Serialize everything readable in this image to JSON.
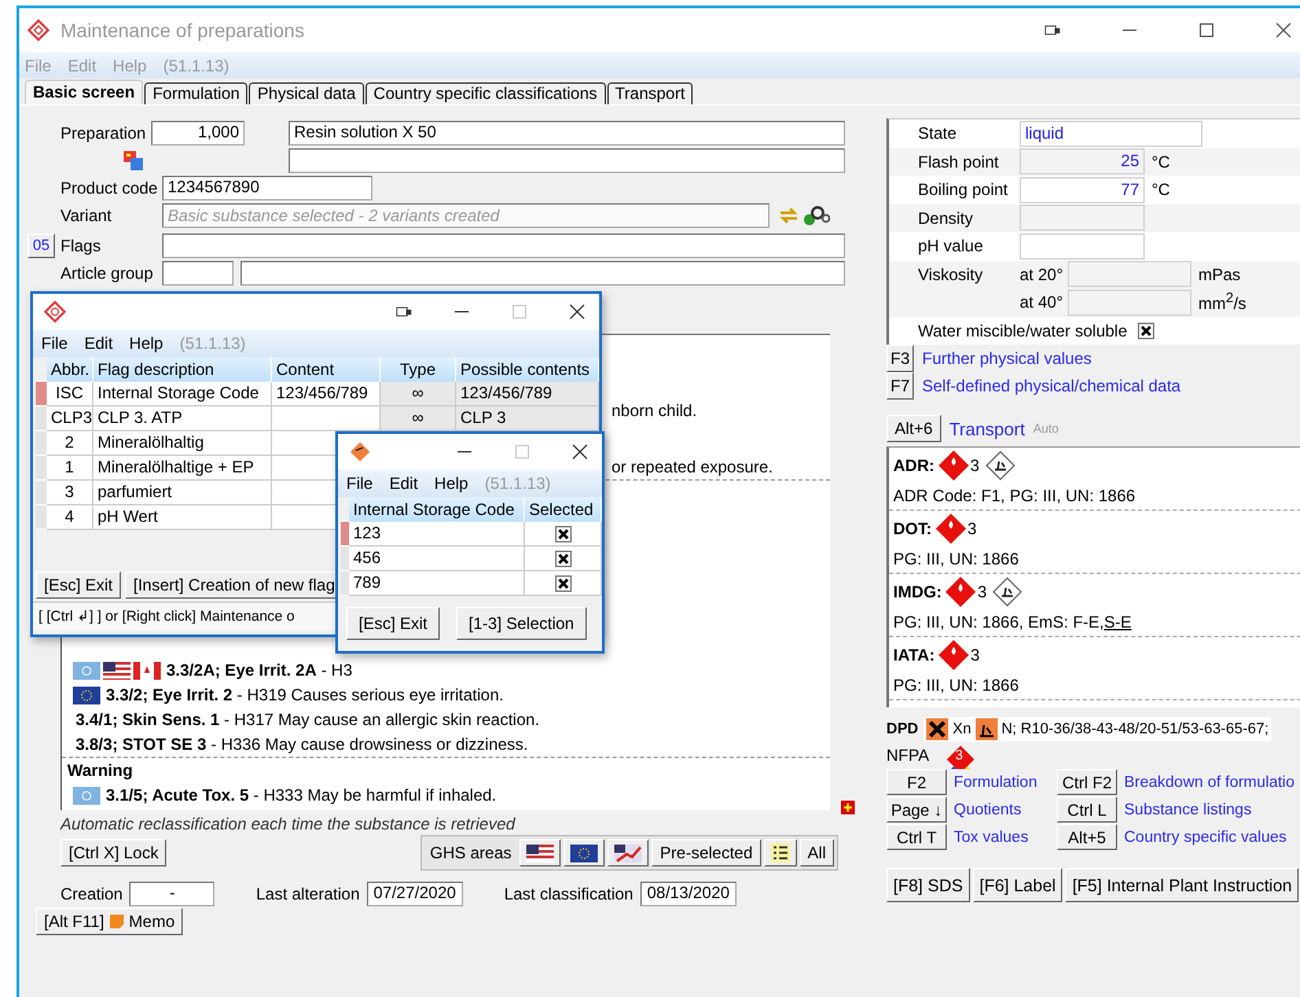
{
  "main_window": {
    "title": "Maintenance of preparations",
    "menu": [
      "File",
      "Edit",
      "Help"
    ],
    "version": "(51.1.13)"
  },
  "tabs": [
    {
      "label": "Basic screen",
      "selected": true
    },
    {
      "label": "Formulation",
      "selected": false
    },
    {
      "label": "Physical data",
      "selected": false
    },
    {
      "label": "Country specific classifications",
      "selected": false
    },
    {
      "label": "Transport",
      "selected": false
    }
  ],
  "form": {
    "preparation_label": "Preparation",
    "preparation_number": "1,000",
    "preparation_name": "Resin solution X 50",
    "product_code_label": "Product code",
    "product_code": "1234567890",
    "variant_label": "Variant",
    "variant_placeholder": "Basic substance selected - 2 variants created",
    "flags_button": "05",
    "flags_label": "Flags",
    "article_group_label": "Article group"
  },
  "hazards": [
    {
      "kind": "fragment",
      "text": "nborn child."
    },
    {
      "kind": "fragment",
      "text": "or repeated exposure."
    },
    {
      "kind": "item",
      "flags": [
        {
          "kind": "un"
        },
        {
          "kind": "us"
        },
        {
          "kind": "ca"
        }
      ],
      "text": "**3.3/2A; Eye Irrit. 2A** - H3"
    },
    {
      "kind": "item",
      "flags": [
        {
          "kind": "eu"
        }
      ],
      "text": "**3.3/2; Eye Irrit. 2** - H319 Causes serious eye irritation."
    },
    {
      "kind": "item",
      "text": "**3.4/1; Skin Sens. 1** - H317 May cause an allergic skin reaction."
    },
    {
      "kind": "item",
      "text": "**3.8/3; STOT SE 3** - H336 May cause drowsiness or dizziness."
    },
    {
      "kind": "heading",
      "text": "Warning"
    },
    {
      "kind": "item",
      "flags": [
        {
          "kind": "un"
        }
      ],
      "text": "**3.1/5; Acute Tox. 5** - H333 May be harmful if inhaled."
    }
  ],
  "reclassification_note": "Automatic reclassification each time the substance is retrieved",
  "lock_button": "[Ctrl X] Lock",
  "ghs_toolbar": {
    "label": "GHS areas",
    "buttons": [
      {
        "kind": "us"
      },
      {
        "kind": "eu"
      },
      {
        "kind": "chart"
      },
      {
        "kind": "text",
        "label": "Pre-selected"
      },
      {
        "kind": "list"
      },
      {
        "kind": "text",
        "label": "All"
      }
    ]
  },
  "dates": [
    {
      "label": "Creation",
      "value": "-"
    },
    {
      "label": "Last alteration",
      "value": "07/27/2020"
    },
    {
      "label": "Last classification",
      "value": "08/13/2020"
    }
  ],
  "memo_button": {
    "shortcut": "[Alt F11]",
    "label": "Memo"
  },
  "physical": [
    {
      "kind": "text",
      "label": "State",
      "value": "liquid"
    },
    {
      "kind": "number",
      "label": "Flash point",
      "value": "25",
      "unit": "°C"
    },
    {
      "kind": "number",
      "label": "Boiling point",
      "value": "77",
      "unit": "°C"
    },
    {
      "kind": "number",
      "label": "Density"
    },
    {
      "kind": "number",
      "label": "pH value"
    },
    {
      "kind": "viscosity",
      "label": "Viskosity",
      "readings": [
        {
          "label": "at 20°",
          "unit": "mPas"
        },
        {
          "label": "at 40°",
          "unit": "mm$^{2}$/s"
        }
      ]
    },
    {
      "kind": "check",
      "label": "Water miscible/water soluble",
      "checked": true
    }
  ],
  "physical_links": [
    {
      "key": "F3",
      "label": "Further physical values"
    },
    {
      "key": "F7",
      "label": "Self-defined physical/chemical data"
    }
  ],
  "transport_header": {
    "key": "Alt+6",
    "label": "Transport",
    "mode": "Auto"
  },
  "transport": [
    {
      "mode": "ADR:",
      "hazard_class": "3",
      "environment": true,
      "details": "ADR Code: F1, PG: III, UN: 1866"
    },
    {
      "mode": "DOT:",
      "hazard_class": "3",
      "environment": false,
      "details": "PG: III, UN: 1866"
    },
    {
      "mode": "IMDG:",
      "hazard_class": "3",
      "environment": true,
      "details": "PG: III, UN: 1866, EmS: F-E,",
      "link": "S-E"
    },
    {
      "mode": "IATA:",
      "hazard_class": "3",
      "environment": false,
      "details": "PG: III, UN: 1866"
    }
  ],
  "dpd": {
    "label": "DPD",
    "symbol": "Xn",
    "phrases": "N; R10-36/38-43-48/20-51/53-63-65-67;"
  },
  "nfpa": {
    "label": "NFPA",
    "flammability": "3"
  },
  "shortcuts": [
    {
      "key": "F2",
      "label": "Formulation"
    },
    {
      "key": "Ctrl F2",
      "label": "Breakdown of formulatio"
    },
    {
      "key": "Page ↓",
      "label": "Quotients"
    },
    {
      "key": "Ctrl L",
      "label": "Substance listings"
    },
    {
      "key": "Ctrl T",
      "label": "Tox values"
    },
    {
      "key": "Alt+5",
      "label": "Country specific values"
    }
  ],
  "document_buttons": [
    "[F8] SDS",
    "[F6] Label",
    "[F5] Internal Plant Instruction"
  ],
  "flag_dialog": {
    "menu": [
      "File",
      "Edit",
      "Help"
    ],
    "version": "(51.1.13)",
    "columns": [
      "Abbr.",
      "Flag description",
      "Content",
      "Type",
      "Possible contents"
    ],
    "rows": [
      {
        "selected": true,
        "abbr": "ISC",
        "description": "Internal Storage Code",
        "content": "123/456/789",
        "type": "∞",
        "possible": "123/456/789"
      },
      {
        "selected": false,
        "abbr": "CLP3",
        "description": "CLP 3. ATP",
        "type": "∞",
        "possible": "CLP 3"
      },
      {
        "selected": false,
        "abbr": "2",
        "description": "Mineralölhaltig"
      },
      {
        "selected": false,
        "abbr": "1",
        "description": "Mineralölhaltige + EP"
      },
      {
        "selected": false,
        "abbr": "3",
        "description": "parfumiert"
      },
      {
        "selected": false,
        "abbr": "4",
        "description": "pH Wert"
      }
    ],
    "buttons": [
      "[Esc] Exit",
      "[Insert] Creation of new flag"
    ],
    "status": "[ [Ctrl ↲] ] or [Right click] Maintenance o"
  },
  "selection_dialog": {
    "menu": [
      "File",
      "Edit",
      "Help"
    ],
    "version": "(51.1.13)",
    "columns": [
      "Internal Storage Code",
      "Selected"
    ],
    "rows": [
      {
        "selected": true,
        "code": "123",
        "checked": true
      },
      {
        "selected": false,
        "code": "456",
        "checked": true
      },
      {
        "selected": false,
        "code": "789",
        "checked": true
      }
    ],
    "buttons": [
      "[Esc] Exit",
      "[1-3] Selection"
    ]
  }
}
